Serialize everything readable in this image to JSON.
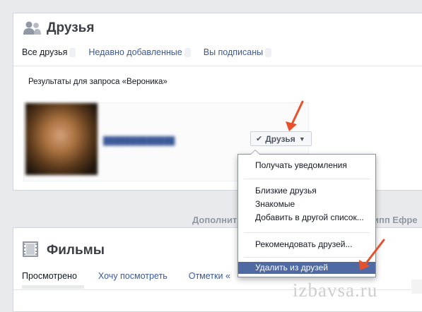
{
  "friends_section": {
    "title": "Друзья",
    "tabs": [
      {
        "label": "Все друзья",
        "active": true
      },
      {
        "label": "Недавно добавленные",
        "active": false
      },
      {
        "label": "Вы подписаны",
        "active": false
      }
    ],
    "search_results_label": "Результаты для запроса «Вероника»",
    "result": {
      "friends_button_label": "Друзья"
    }
  },
  "between_row": {
    "left_text": "Дополнит",
    "right_text": "ипп Ефре"
  },
  "movies_section": {
    "title": "Фильмы",
    "tabs": [
      {
        "label": "Просмотрено",
        "active": true
      },
      {
        "label": "Хочу посмотреть",
        "active": false
      },
      {
        "label": "Отметки «",
        "active": false
      }
    ]
  },
  "friend_menu": {
    "items": [
      {
        "label": "Получать уведомления",
        "highlighted": false
      },
      {
        "label": "Близкие друзья",
        "highlighted": false
      },
      {
        "label": "Знакомые",
        "highlighted": false
      },
      {
        "label": "Добавить в другой список...",
        "highlighted": false
      },
      {
        "label": "Рекомендовать друзей...",
        "highlighted": false
      },
      {
        "label": "Удалить из друзей",
        "highlighted": true
      }
    ]
  },
  "watermark": "izbavsa.ru",
  "colors": {
    "link": "#3b5998",
    "menu_highlight": "#4f6aa3",
    "arrow": "#e8502c",
    "page_bg": "#e9eaed"
  },
  "icons": {
    "friends_header": "people-icon",
    "movies_header": "film-strip-icon",
    "button_check": "check-icon",
    "button_caret": "caret-down-icon"
  }
}
